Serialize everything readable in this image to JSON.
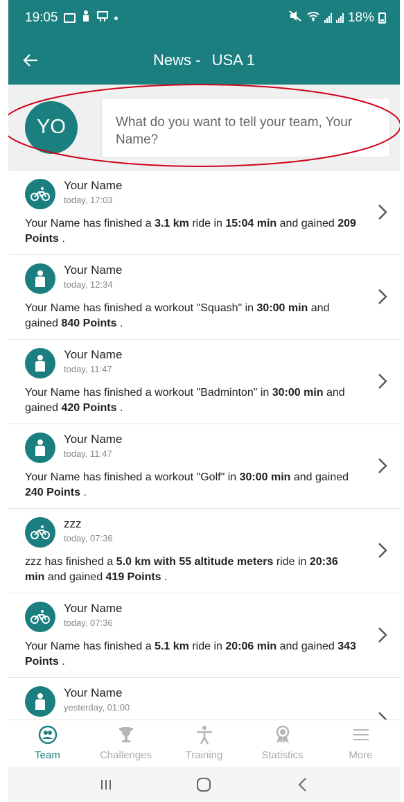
{
  "status_bar": {
    "time": "19:05",
    "battery": "18%"
  },
  "app_bar": {
    "title_prefix": "News -",
    "team_name": "USA 1"
  },
  "composer": {
    "avatar_initials": "YO",
    "placeholder": "What do you want to tell your team, Your Name?"
  },
  "feed": [
    {
      "author": "Your Name",
      "time": "today, 17:03",
      "icon": "bike-icon",
      "parts": [
        [
          "Your Name has finished a ",
          false
        ],
        [
          "3.1 km",
          true
        ],
        [
          " ride in ",
          false
        ],
        [
          "15:04 min",
          true
        ],
        [
          " and gained ",
          false
        ],
        [
          "209 Points",
          true
        ],
        [
          " .",
          false
        ]
      ]
    },
    {
      "author": "Your Name",
      "time": "today, 12:34",
      "icon": "person-icon",
      "parts": [
        [
          "Your Name has finished a workout \"Squash\" in ",
          false
        ],
        [
          "30:00 min",
          true
        ],
        [
          " and gained ",
          false
        ],
        [
          "840 Points",
          true
        ],
        [
          " .",
          false
        ]
      ]
    },
    {
      "author": "Your Name",
      "time": "today, 11:47",
      "icon": "person-icon",
      "parts": [
        [
          "Your Name has finished a workout \"Badminton\" in ",
          false
        ],
        [
          "30:00 min",
          true
        ],
        [
          " and gained ",
          false
        ],
        [
          "420 Points",
          true
        ],
        [
          " .",
          false
        ]
      ]
    },
    {
      "author": "Your Name",
      "time": "today, 11:47",
      "icon": "person-icon",
      "parts": [
        [
          "Your Name has finished a workout \"Golf\" in ",
          false
        ],
        [
          "30:00 min",
          true
        ],
        [
          " and gained ",
          false
        ],
        [
          "240 Points",
          true
        ],
        [
          " .",
          false
        ]
      ]
    },
    {
      "author": "zzz",
      "time": "today, 07:36",
      "icon": "bike-icon",
      "parts": [
        [
          "zzz has finished a ",
          false
        ],
        [
          "5.0 km with 55 altitude meters",
          true
        ],
        [
          " ride in ",
          false
        ],
        [
          "20:36 min",
          true
        ],
        [
          " and gained ",
          false
        ],
        [
          "419 Points",
          true
        ],
        [
          " .",
          false
        ]
      ]
    },
    {
      "author": "Your Name",
      "time": "today, 07:36",
      "icon": "bike-icon",
      "parts": [
        [
          "Your Name has finished a ",
          false
        ],
        [
          "5.1 km",
          true
        ],
        [
          " ride in ",
          false
        ],
        [
          "20:06 min",
          true
        ],
        [
          " and gained ",
          false
        ],
        [
          "343 Points",
          true
        ],
        [
          " .",
          false
        ]
      ]
    },
    {
      "author": "Your Name",
      "time": "yesterday, 01:00",
      "icon": "person-icon",
      "parts": []
    }
  ],
  "bottom_nav": [
    {
      "label": "Team",
      "icon": "team-icon",
      "active": true
    },
    {
      "label": "Challenges",
      "icon": "trophy-icon",
      "active": false
    },
    {
      "label": "Training",
      "icon": "training-icon",
      "active": false
    },
    {
      "label": "Statistics",
      "icon": "medal-icon",
      "active": false
    },
    {
      "label": "More",
      "icon": "menu-icon",
      "active": false
    }
  ],
  "colors": {
    "primary": "#1b7f7f",
    "highlight": "#d0021b",
    "inactive": "#aaaaaa"
  }
}
